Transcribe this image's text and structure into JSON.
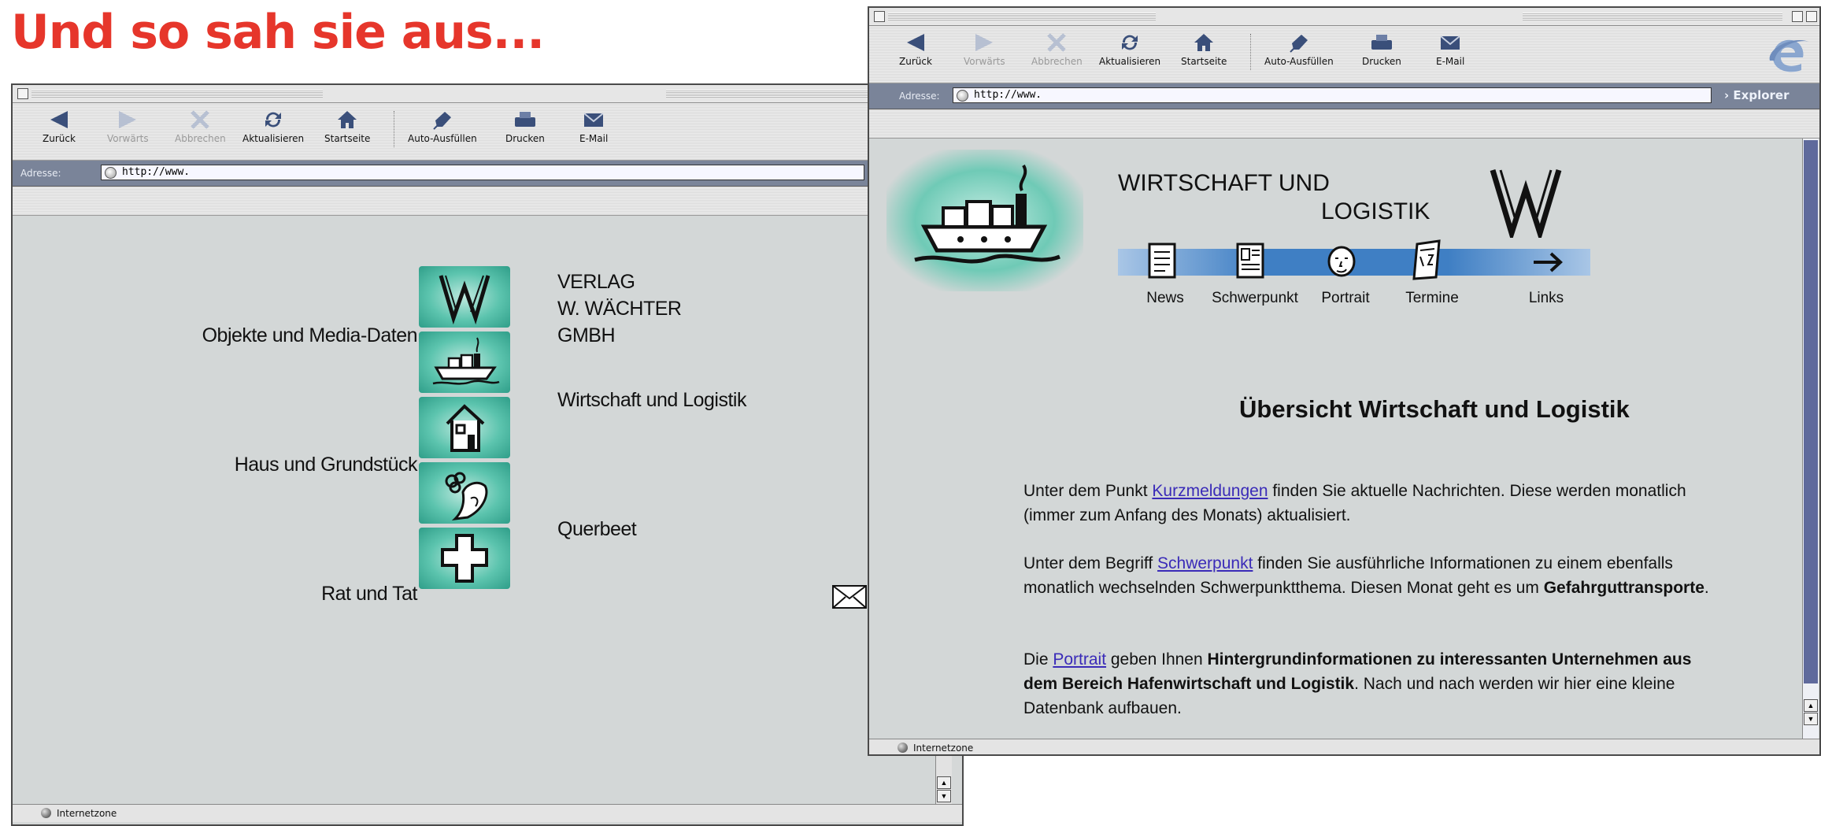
{
  "headline": "Und so sah sie aus...",
  "toolbar": {
    "back": "Zurück",
    "forward": "Vorwärts",
    "stop": "Abbrechen",
    "refresh": "Aktualisieren",
    "home": "Startseite",
    "autofill": "Auto-Ausfüllen",
    "print": "Drucken",
    "mail": "E-Mail"
  },
  "address": {
    "label": "Adresse:",
    "url": "http://www."
  },
  "explorer_tab": "› Explorer",
  "status": "Internetzone",
  "left_page": {
    "publisher": [
      "VERLAG",
      "W. WÄCHTER",
      "GMBH"
    ],
    "items": [
      "Objekte und Media-Daten",
      "Wirtschaft und Logistik",
      "Haus und Grundstück",
      "Querbeet",
      "Rat und Tat"
    ]
  },
  "right_page": {
    "logo_line1": "WIRTSCHAFT UND",
    "logo_line2": "LOGISTIK",
    "nav": [
      "News",
      "Schwerpunkt",
      "Portrait",
      "Termine",
      "Links"
    ],
    "heading": "Übersicht Wirtschaft und Logistik",
    "p1_pre": "Unter dem Punkt ",
    "p1_link": "Kurzmeldungen",
    "p1_post": " finden Sie aktuelle Nachrichten. Diese werden monatlich (immer zum Anfang des Monats) aktualisiert.",
    "p2_pre": "Unter dem Begriff ",
    "p2_link": "Schwerpunkt",
    "p2_post": " finden Sie ausführliche Informationen zu einem ebenfalls monatlich wechselnden Schwerpunktthema. Diesen Monat geht es um ",
    "p2_bold": "Gefahrguttransporte",
    "p2_end": ".",
    "p3_pre": "Die ",
    "p3_link": "Portrait",
    "p3_mid": " geben Ihnen ",
    "p3_bold": "Hintergrundinformationen zu interessanten Unternehmen aus dem Bereich Hafenwirtschaft und Logistik",
    "p3_post": ". Nach und nach werden wir hier eine kleine Datenbank aufbauen."
  },
  "colors": {
    "headline": "#e6362b",
    "teal": "#5cc4ae",
    "link": "#3a2bb8",
    "nav_band": "#3f7fc4"
  }
}
